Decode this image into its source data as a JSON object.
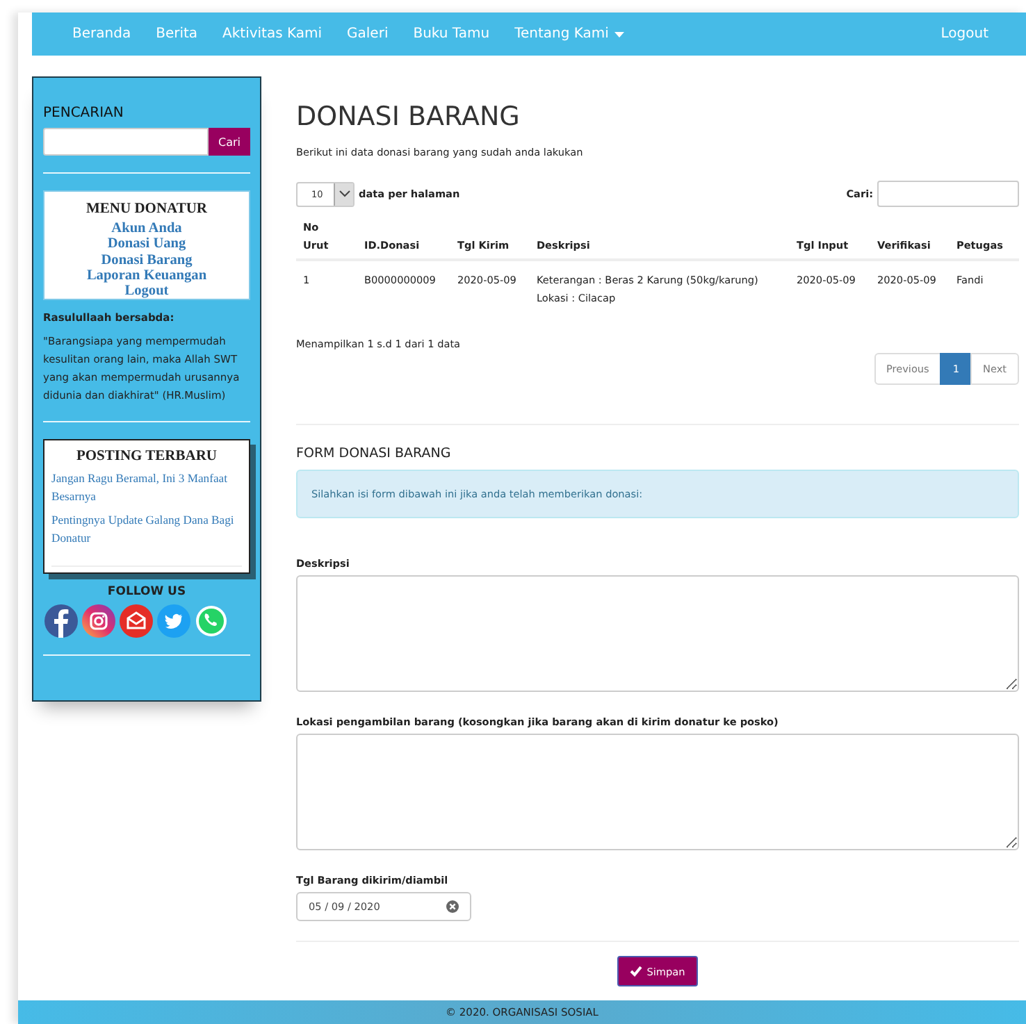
{
  "navbar": {
    "items": [
      {
        "label": "Beranda",
        "dropdown": false
      },
      {
        "label": "Berita",
        "dropdown": false
      },
      {
        "label": "Aktivitas Kami",
        "dropdown": false
      },
      {
        "label": "Galeri",
        "dropdown": false
      },
      {
        "label": "Buku Tamu",
        "dropdown": false
      },
      {
        "label": "Tentang Kami",
        "dropdown": true
      }
    ],
    "right": "Logout"
  },
  "sidebar": {
    "search": {
      "title": "PENCARIAN",
      "button": "Cari"
    },
    "menu": {
      "title": "MENU DONATUR",
      "items": [
        "Akun Anda",
        "Donasi Uang",
        "Donasi Barang",
        "Laporan Keuangan",
        "Logout"
      ]
    },
    "hadith_title": "Rasulullaah bersabda:",
    "hadith": "\"Barangsiapa yang  mempermudah kesulitan orang lain, maka Allah SWT yang akan mempermudah urusannya didunia dan diakhirat\" (HR.Muslim)",
    "posts": {
      "title": "POSTING TERBARU",
      "items": [
        "Jangan Ragu Beramal, Ini 3 Manfaat Besarnya",
        "Pentingnya Update Galang Dana Bagi Donatur"
      ]
    },
    "follow_title": "FOLLOW US",
    "social": [
      {
        "kind": "facebook"
      },
      {
        "kind": "instagram"
      },
      {
        "kind": "email"
      },
      {
        "kind": "twitter"
      },
      {
        "kind": "whatsapp"
      }
    ]
  },
  "main": {
    "title": "DONASI BARANG",
    "subtitle": "Berikut ini data donasi barang yang sudah anda lakukan",
    "page_size": "10",
    "page_size_label": "data per halaman",
    "search_label": "Cari:",
    "table": {
      "columns": [
        "No Urut",
        "ID.Donasi",
        "Tgl Kirim",
        "Deskripsi",
        "Tgl Input",
        "Verifikasi",
        "Petugas"
      ],
      "rows": [
        [
          [
            "1"
          ],
          [
            "B0000000009"
          ],
          [
            "2020-05-09"
          ],
          [
            "Keterangan : Beras 2 Karung (50kg/karung)",
            "Lokasi : Cilacap"
          ],
          [
            "2020-05-09"
          ],
          [
            "2020-05-09"
          ],
          [
            "Fandi"
          ]
        ]
      ]
    },
    "info": "Menampilkan 1 s.d 1 dari 1 data",
    "pagination": [
      {
        "label": "Previous",
        "selected": false
      },
      {
        "label": "1",
        "selected": true
      },
      {
        "label": "Next",
        "selected": false
      }
    ]
  },
  "form": {
    "title": "FORM DONASI BARANG",
    "alert": "Silahkan isi form dibawah ini jika anda telah memberikan donasi:",
    "description_label": "Deskripsi",
    "location_label": "Lokasi pengambilan barang (kosongkan jika barang akan di kirim donatur ke posko)",
    "date_label": "Tgl Barang dikirim/diambil",
    "date_value": "05 / 09 / 2020",
    "submit": "Simpan"
  },
  "footer": "© 2020. ORGANISASI SOSIAL"
}
